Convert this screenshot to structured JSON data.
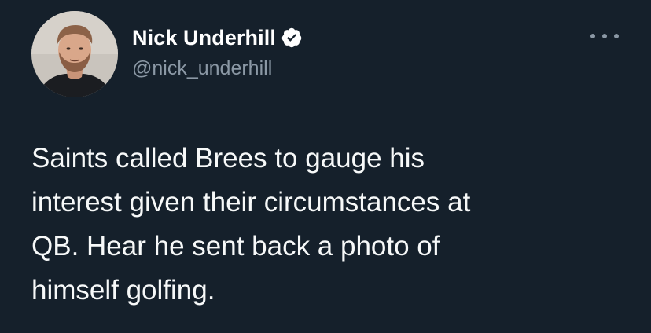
{
  "author": {
    "display_name": "Nick Underhill",
    "handle": "@nick_underhill",
    "verified": true,
    "avatar_icon": "profile-photo"
  },
  "menu": {
    "icon": "more-options-icon"
  },
  "tweet": {
    "lines": [
      "Saints called Brees to gauge his",
      "interest given their circumstances at",
      "QB. Hear he sent back a photo of",
      "himself golfing."
    ]
  },
  "colors": {
    "background": "#15202b",
    "text": "#f7f9f9",
    "secondary_text": "#8b98a5",
    "verified_badge": "#ffffff"
  }
}
